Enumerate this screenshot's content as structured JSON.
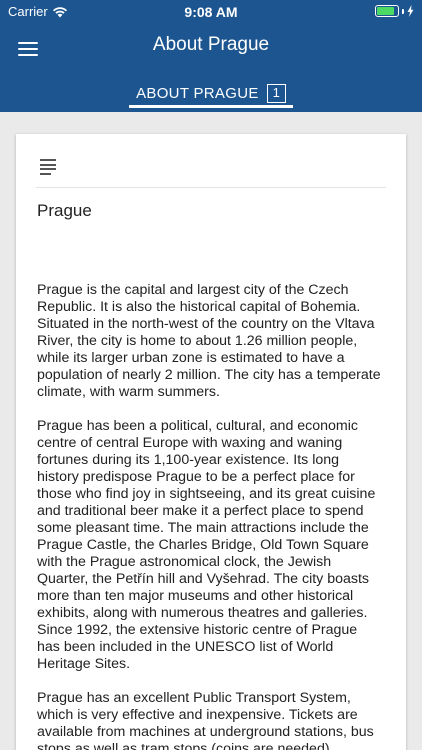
{
  "statusbar": {
    "carrier": "Carrier",
    "time": "9:08 AM",
    "battery_level": 0.85
  },
  "appbar": {
    "title": "About Prague",
    "menu_icon": "hamburger-menu-icon"
  },
  "tabs": [
    {
      "label": "ABOUT PRAGUE",
      "count": "1",
      "selected": true
    }
  ],
  "article": {
    "icon": "article-lines-icon",
    "title": "Prague",
    "paragraphs": [
      "Prague is the capital and largest city of the Czech Republic. It is also the historical capital of Bohemia. Situated in the north-west of the country on the Vltava River, the city is home to about 1.26 million people, while its larger urban zone is estimated to have a population of nearly 2 million. The city has a temperate climate, with warm summers.",
      "Prague has been a political, cultural, and economic centre of central Europe with waxing and waning fortunes during its 1,100-year existence. Its long history predispose Prague to be a perfect place for those who find joy in sightseeing, and its great cuisine and traditional beer make it a perfect place to spend some pleasant time. The main attractions include the Prague Castle, the Charles Bridge, Old Town Square with the Prague astronomical clock, the Jewish Quarter, the Petřín hill and Vyšehrad. The city boasts more than ten major museums and other historical exhibits, along with numerous theatres and galleries. Since 1992, the extensive historic centre of Prague has been included in the UNESCO list of World Heritage Sites.",
      "Prague has an excellent Public Transport System, which is very effective and inexpensive. Tickets are available from machines at underground stations, bus stops as well as tram stops (coins are needed)"
    ]
  },
  "colors": {
    "primary": "#1c5590",
    "background": "#eaeaea",
    "card": "#ffffff",
    "battery": "#4cd964"
  }
}
